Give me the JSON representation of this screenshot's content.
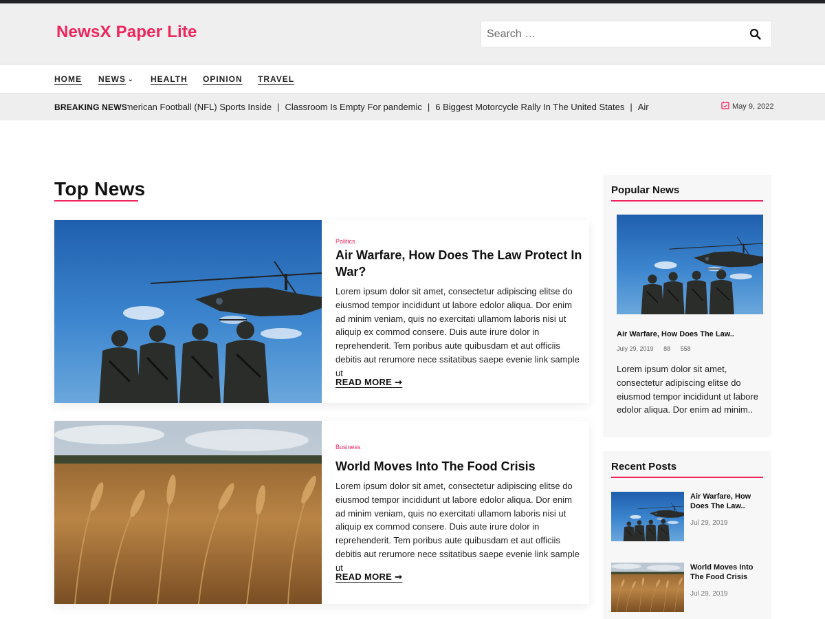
{
  "site": {
    "title": "NewsX Paper Lite",
    "accent": "#f0245c"
  },
  "search": {
    "placeholder": "Search …"
  },
  "nav": {
    "items": [
      "HOME",
      "NEWS",
      "HEALTH",
      "OPINION",
      "TRAVEL"
    ]
  },
  "ticker": {
    "label": "BREAKING NEWS",
    "items": [
      "American Football (NFL) Sports Inside",
      "Classroom Is Empty For pandemic",
      "6 Biggest Motorcycle Rally In The United States",
      "Air Warfare, How Does The Law Protect In War?"
    ],
    "separator": "|",
    "date": "May 9, 2022"
  },
  "main": {
    "section_title": "Top News",
    "cards": [
      {
        "category": "Politics",
        "title": "Air Warfare, How Does The Law Protect In War?",
        "excerpt": "Lorem ipsum dolor sit amet, consectetur adipiscing elitse do eiusmod tempor incididunt ut labore edolor aliqua. Dor enim ad minim veniam, quis no exercitati ullamom laboris nisi ut aliquip ex commod consere. Duis aute irure dolor in reprehenderit. Tem poribus aute quibusdam et aut officiis debitis aut rerumore nece ssitatibus saepe evenie link sample ut",
        "read_more": "READ MORE"
      },
      {
        "category": "Business",
        "title": "World Moves Into The Food Crisis",
        "excerpt": "Lorem ipsum dolor sit amet, consectetur adipiscing elitse do eiusmod tempor incididunt ut labore edolor aliqua. Dor enim ad minim veniam, quis no exercitati ullamom laboris nisi ut aliquip ex commod consere. Duis aute irure dolor in reprehenderit. Tem poribus aute quibusdam et aut officiis debitis aut rerumore nece ssitatibus saepe evenie link sample ut",
        "read_more": "READ MORE"
      }
    ]
  },
  "sidebar": {
    "popular": {
      "title": "Popular News",
      "post_title": "Air Warfare, How Does The Law..",
      "date": "July 29, 2019",
      "comments": "88",
      "views": "558",
      "excerpt": "Lorem ipsum dolor sit amet, consectetur adipiscing elitse do eiusmod tempor incididunt ut labore edolor aliqua. Dor enim ad minim.."
    },
    "recent": {
      "title": "Recent Posts",
      "items": [
        {
          "title": "Air Warfare, How Does The Law..",
          "date": "Jul 29, 2019"
        },
        {
          "title": "World Moves Into The Food Crisis",
          "date": "Jul 29, 2019"
        }
      ]
    }
  }
}
